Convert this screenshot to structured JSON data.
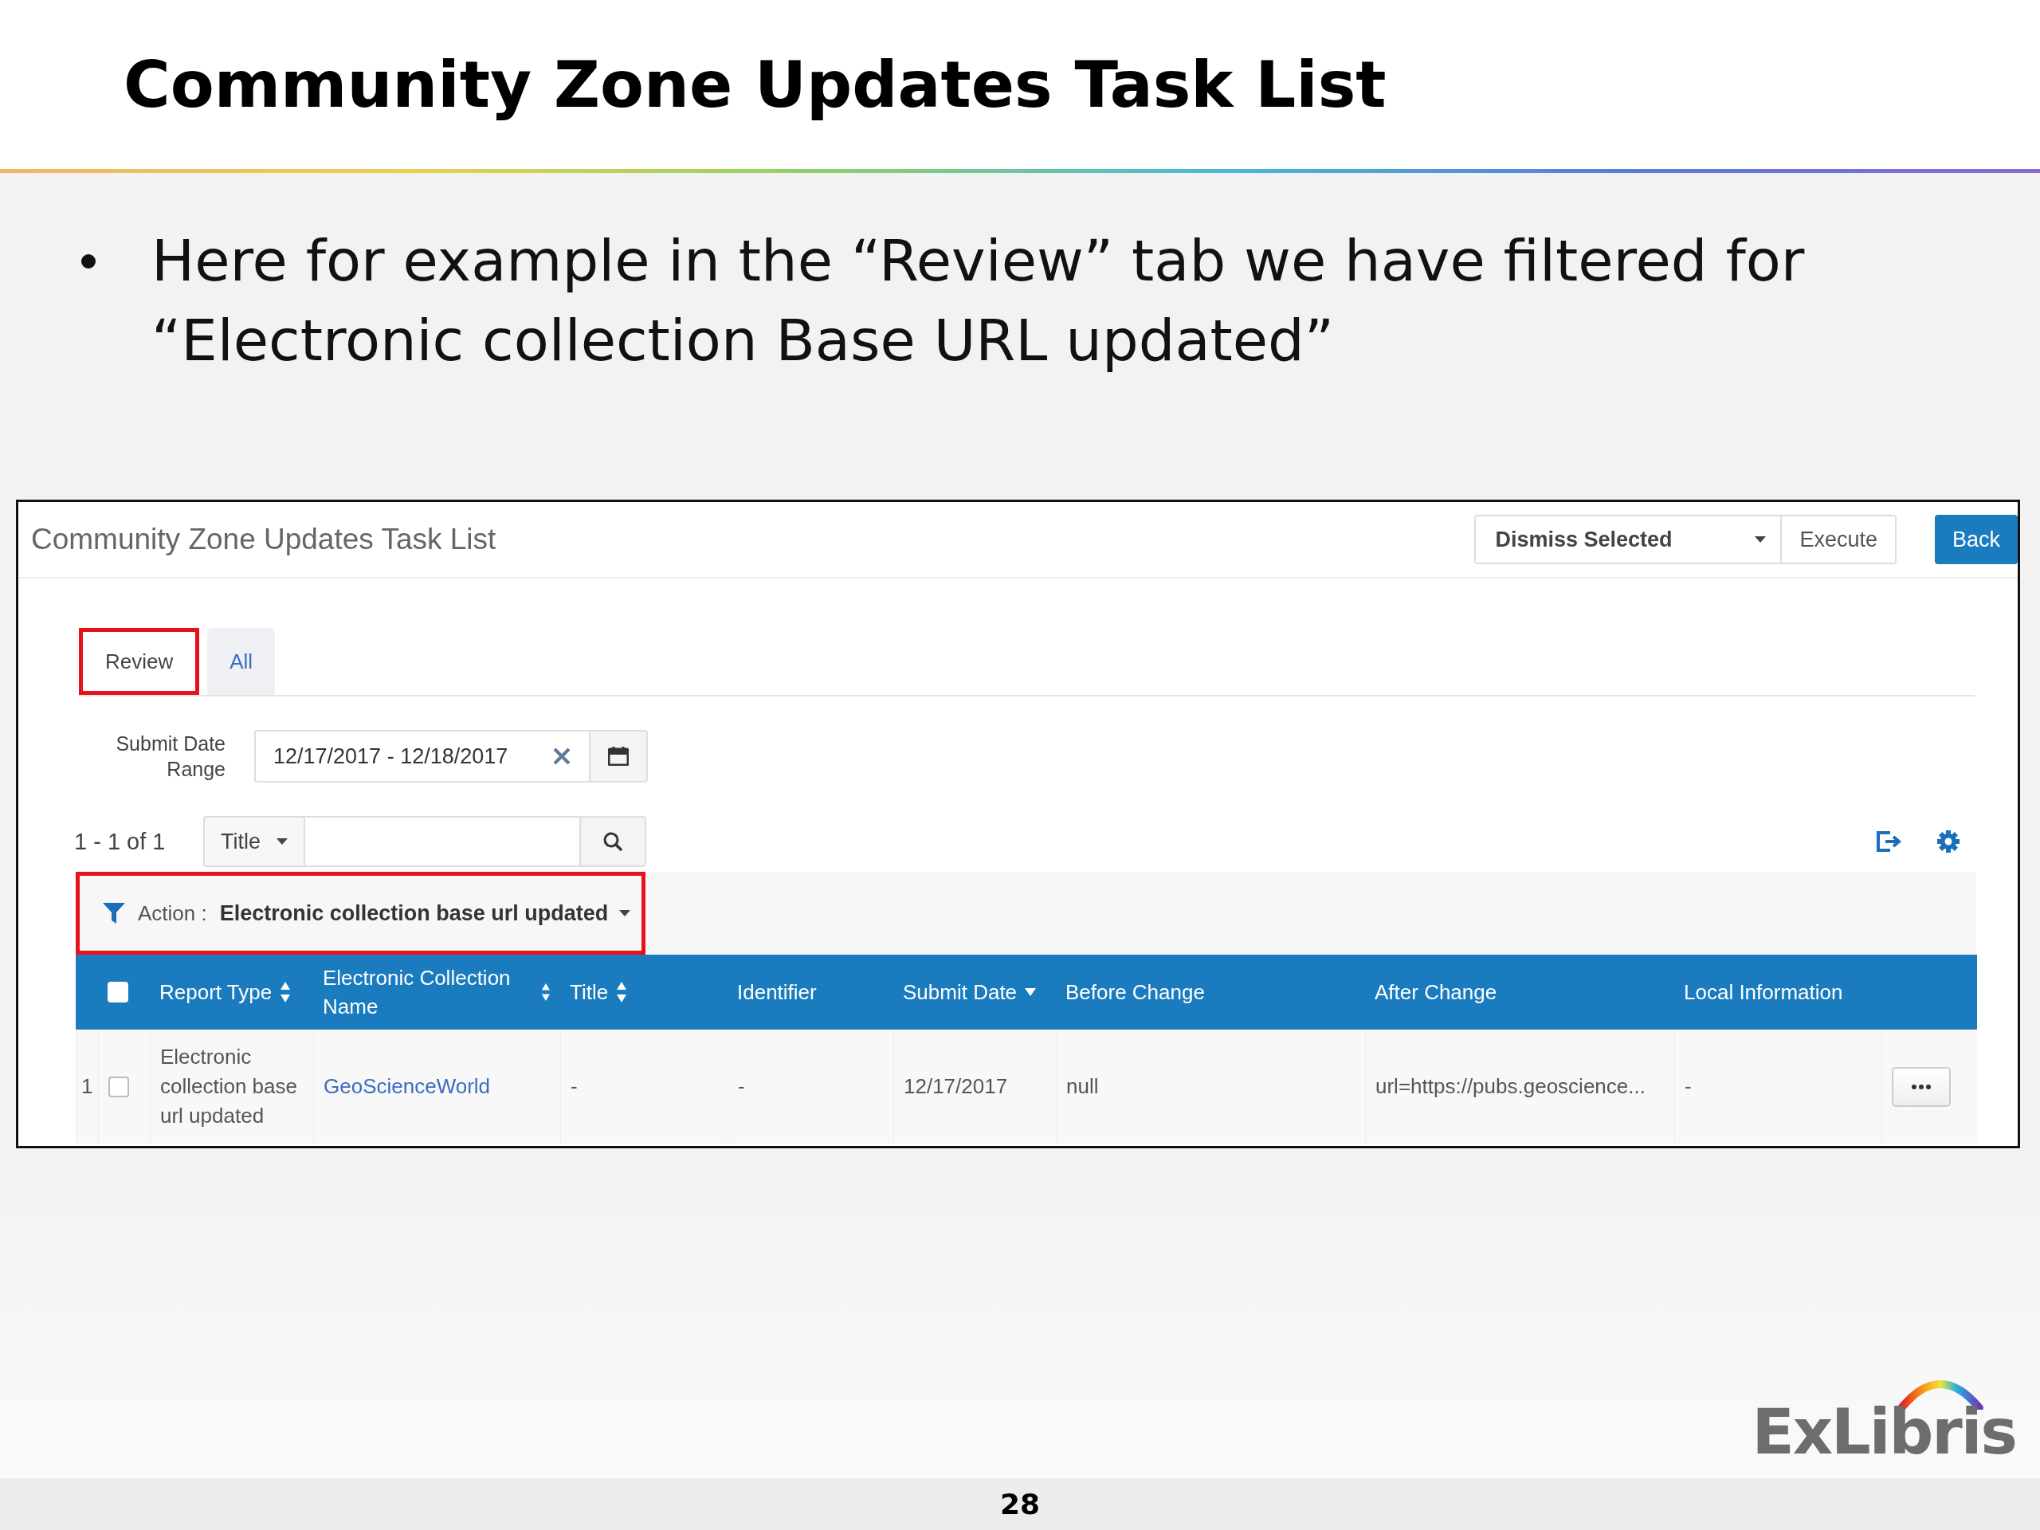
{
  "slide": {
    "title": "Community Zone Updates Task List",
    "bullets": [
      "Here for example in the “Review” tab we have filtered for “Electronic collection Base URL updated”"
    ],
    "logo": "ExLibris",
    "page_number": "28"
  },
  "app": {
    "title": "Community Zone Updates Task List",
    "action_select": {
      "value": "Dismiss Selected"
    },
    "buttons": [
      {
        "label": "Execute",
        "kind": "default"
      },
      {
        "label": "Back",
        "kind": "primary"
      }
    ],
    "tabs": [
      {
        "label": "Review",
        "selected": true,
        "annotated": true
      },
      {
        "label": "All",
        "selected": false,
        "annotated": false
      }
    ],
    "date_filter": {
      "label": "Submit Date Range",
      "value": "12/17/2017 - 12/18/2017"
    },
    "results_count": "1 - 1 of 1",
    "search": {
      "field": "Title"
    },
    "active_filter": {
      "label": "Action :",
      "value": "Electronic collection base url updated",
      "annotated": true
    },
    "table": {
      "select_all_checked": false,
      "columns": [
        {
          "label": "Report Type",
          "sortable": true,
          "sorted_desc": false
        },
        {
          "label": "Electronic Collection Name",
          "sortable": true,
          "sorted_desc": false
        },
        {
          "label": "Title",
          "sortable": true,
          "sorted_desc": false
        },
        {
          "label": "Identifier",
          "sortable": false,
          "sorted_desc": false
        },
        {
          "label": "Submit Date",
          "sortable": false,
          "sorted_desc": true
        },
        {
          "label": "Before Change",
          "sortable": false,
          "sorted_desc": false
        },
        {
          "label": "After Change",
          "sortable": false,
          "sorted_desc": false
        },
        {
          "label": "Local Information",
          "sortable": false,
          "sorted_desc": false
        }
      ],
      "rows": [
        {
          "number": "1",
          "checked": false,
          "cells": [
            {
              "text": "Electronic collection base url updated",
              "kind": "text"
            },
            {
              "text": "GeoScienceWorld",
              "kind": "link"
            },
            {
              "text": "-",
              "kind": "text"
            },
            {
              "text": "-",
              "kind": "text"
            },
            {
              "text": "12/17/2017",
              "kind": "text"
            },
            {
              "text": "null",
              "kind": "text"
            },
            {
              "text": "url=https://pubs.geoscience...",
              "kind": "text"
            },
            {
              "text": "-",
              "kind": "text"
            }
          ]
        }
      ]
    }
  }
}
